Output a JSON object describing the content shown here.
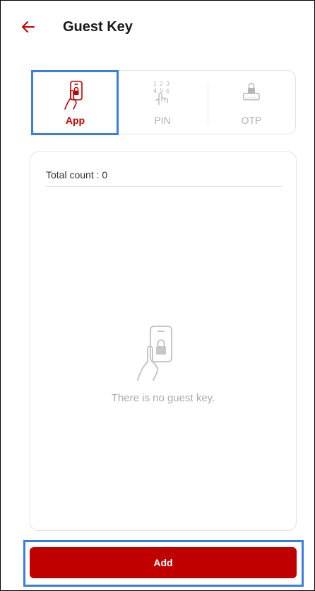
{
  "header": {
    "back_icon": "arrow-left-icon",
    "title": "Guest Key"
  },
  "tabs": [
    {
      "label": "App",
      "icon": "phone-in-hand-icon",
      "selected": true
    },
    {
      "label": "PIN",
      "icon": "keypad-touch-icon",
      "selected": false
    },
    {
      "label": "OTP",
      "icon": "lock-keyboard-icon",
      "selected": false
    }
  ],
  "panel": {
    "total_count_label": "Total count : 0",
    "empty_icon": "phone-in-hand-icon",
    "empty_message": "There is no guest key."
  },
  "footer": {
    "add_label": "Add"
  },
  "colors": {
    "accent": "#c00000",
    "selected_outline": "#3c7ee0",
    "muted_text": "#b0b0b0",
    "border": "#e3e3e3"
  }
}
